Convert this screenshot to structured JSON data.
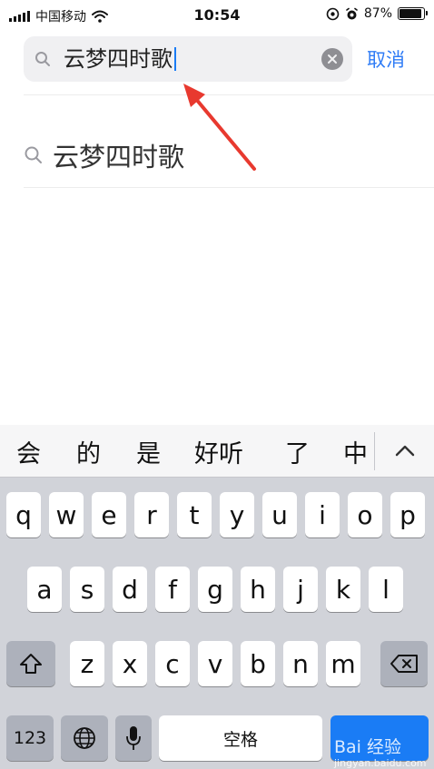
{
  "status_bar": {
    "carrier": "中国移动",
    "time": "10:54",
    "battery_percent_label": "87%",
    "battery_level": 0.87
  },
  "search": {
    "query": "云梦四时歌",
    "cancel_label": "取消"
  },
  "suggestions": [
    {
      "label": "云梦四时歌"
    }
  ],
  "keyboard": {
    "candidates": [
      "会",
      "的",
      "是",
      "好听",
      "了",
      "中"
    ],
    "row1": [
      "q",
      "w",
      "e",
      "r",
      "t",
      "y",
      "u",
      "i",
      "o",
      "p"
    ],
    "row2": [
      "a",
      "s",
      "d",
      "f",
      "g",
      "h",
      "j",
      "k",
      "l"
    ],
    "row3": [
      "z",
      "x",
      "c",
      "v",
      "b",
      "n",
      "m"
    ],
    "numbers_label": "123",
    "space_label": "空格",
    "watermark_line1": "Bai 经验",
    "watermark_line2": "jingyan.baidu.com"
  },
  "colors": {
    "accent": "#2f7cf6",
    "annotation": "#e8392f",
    "keyboard_bg": "#d1d3d9"
  }
}
